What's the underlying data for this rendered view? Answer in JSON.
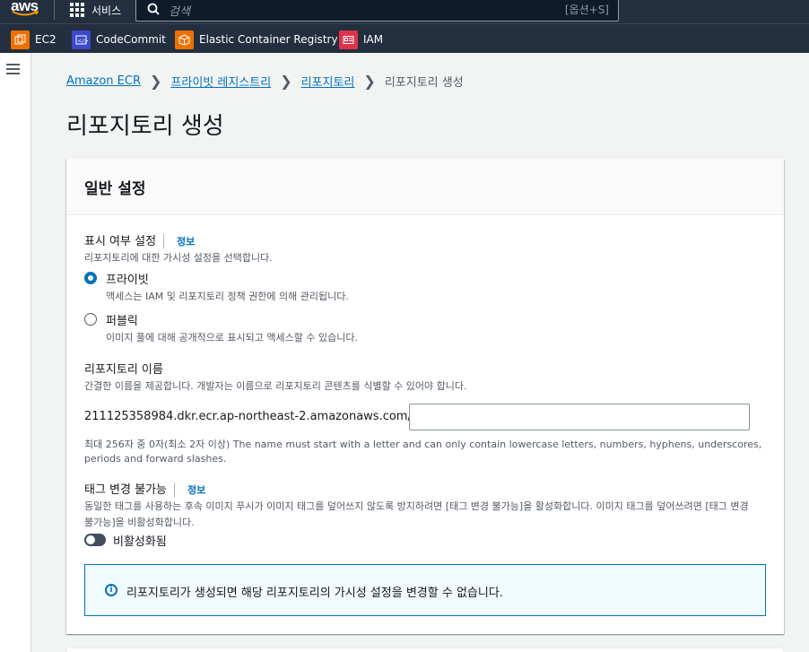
{
  "topnav": {
    "logo": "aws",
    "services_label": "서비스",
    "search_placeholder": "검색",
    "search_shortcut": "[옵션+S]"
  },
  "favorites": [
    {
      "label": "EC2",
      "icon": "ec2-icon",
      "color": "#ed7100"
    },
    {
      "label": "CodeCommit",
      "icon": "codecommit-icon",
      "color": "#3b48cc"
    },
    {
      "label": "Elastic Container Registry",
      "icon": "ecr-icon",
      "color": "#ed7100"
    },
    {
      "label": "IAM",
      "icon": "iam-icon",
      "color": "#dd344c"
    }
  ],
  "breadcrumb": {
    "items": [
      "Amazon ECR",
      "프라이빗 레지스트리",
      "리포지토리"
    ],
    "current": "리포지토리 생성"
  },
  "page_title": "리포지토리 생성",
  "general": {
    "title": "일반 설정",
    "visibility": {
      "label": "표시 여부 설정",
      "info": "정보",
      "description": "리포지토리에 대한 가시성 설정을 선택합니다.",
      "options": [
        {
          "label": "프라이빗",
          "description": "액세스는 IAM 및 리포지토리 정책 권한에 의해 관리됩니다.",
          "selected": true
        },
        {
          "label": "퍼블릭",
          "description": "이미지 풀에 대해 공개적으로 표시되고 액세스할 수 있습니다.",
          "selected": false
        }
      ]
    },
    "repo_name": {
      "label": "리포지토리 이름",
      "description": "간결한 이름을 제공합니다. 개발자는 이름으로 리포지토리 콘텐츠를 식별할 수 있어야 합니다.",
      "prefix": "211125358984.dkr.ecr.ap-northeast-2.amazonaws.com/",
      "value": "",
      "constraint_line1": "최대 256자 중 0자(최소 2자 이상) The name must start with a letter and can only contain lowercase letters, numbers, hyphens, underscores,",
      "constraint_line2": "periods and forward slashes."
    },
    "tag_immutability": {
      "label": "태그 변경 불가능",
      "info": "정보",
      "description_line1": "동일한 태그를 사용하는 후속 이미지 푸시가 이미지 태그를 덮어쓰지 않도록 방지하려면 [태그 변경 불가능]을 활성화합니다. 이미지 태그를 덮어쓰려면 [태그 변경",
      "description_line2": "불가능]을 비활성화합니다.",
      "toggle_label": "비활성화됨",
      "enabled": false
    },
    "alert": "리포지토리가 생성되면 해당 리포지토리의 가시성 설정을 변경할 수 없습니다."
  }
}
